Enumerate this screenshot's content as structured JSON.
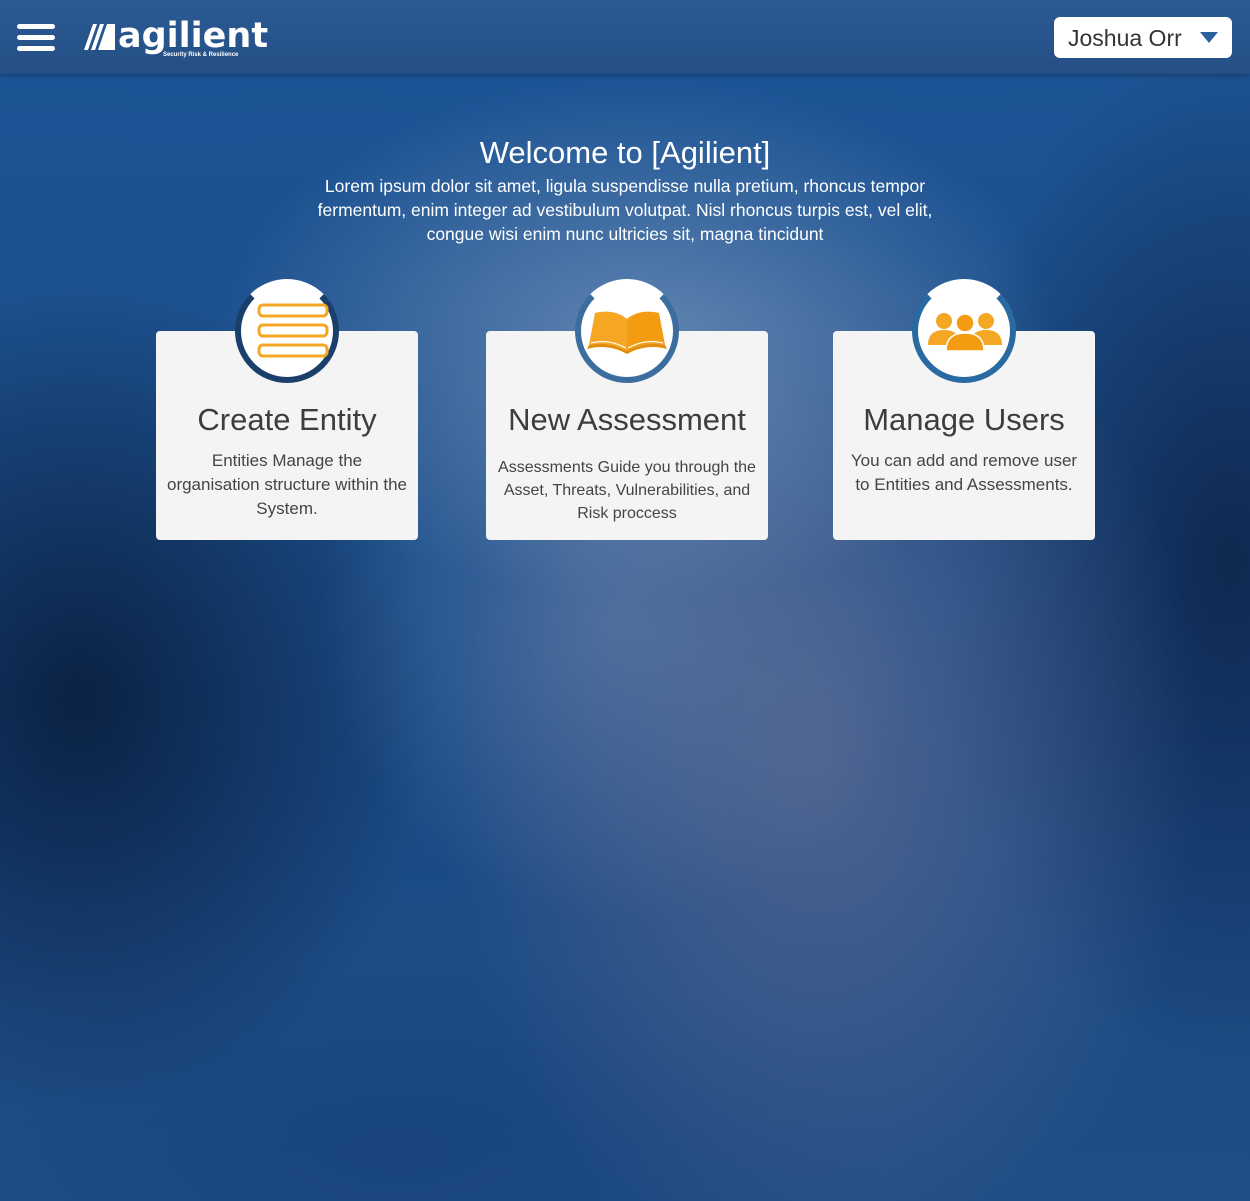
{
  "header": {
    "brand": "agilient",
    "brand_tagline": "Security Risk & Resilience",
    "user_name": "Joshua Orr"
  },
  "welcome": {
    "title": "Welcome to [Agilient]",
    "text": "Lorem ipsum dolor sit amet, ligula suspendisse nulla pretium, rhoncus tempor fermentum, enim integer ad vestibulum volutpat. Nisl rhoncus turpis est, vel elit, congue wisi enim nunc ultricies sit, magna tincidunt"
  },
  "cards": [
    {
      "icon": "list-icon",
      "title": "Create Entity",
      "description": "Entities Manage the organisation structure within the System."
    },
    {
      "icon": "open-book-icon",
      "title": "New Assessment",
      "description": "Assessments Guide you through the Asset, Threats, Vulnerabilities, and Risk proccess"
    },
    {
      "icon": "users-group-icon",
      "title": "Manage Users",
      "description": "You can add and remove user to Entities and Assessments."
    }
  ],
  "colors": {
    "accent": "#f5a623",
    "header_bg": "#2b5a93",
    "card_bg": "#f4f4f4",
    "ring": "#24507f"
  }
}
